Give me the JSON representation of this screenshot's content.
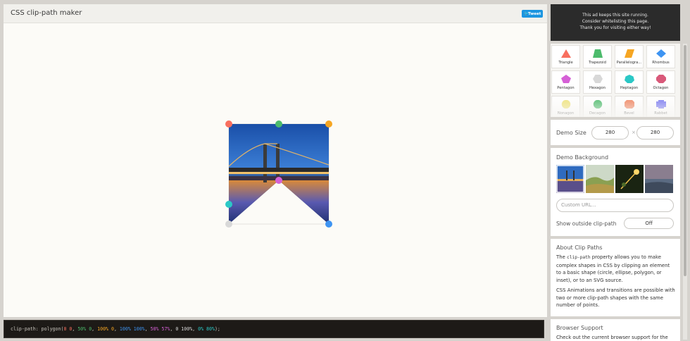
{
  "header": {
    "title": "CSS clip-path maker",
    "tweet_label": "Tweet"
  },
  "code": {
    "prefix": "clip-path: polygon(",
    "points": [
      "0 0",
      "50% 0",
      "100% 0",
      "100% 100%",
      "50% 57%",
      "0 100%",
      "0% 80%"
    ],
    "suffix": ");"
  },
  "ad": {
    "line1": "This ad keeps this site running.",
    "line2": "Consider whitelisting this page.",
    "line3": "Thank you for visiting either way!"
  },
  "shapes": [
    {
      "label": "Triangle",
      "icon": "triangle-icon",
      "color": "#f86f5f"
    },
    {
      "label": "Trapezoid",
      "icon": "trapezoid-icon",
      "color": "#4cbb6c"
    },
    {
      "label": "Parallelogra...",
      "icon": "parallelogram-icon",
      "color": "#f6a623"
    },
    {
      "label": "Rhombus",
      "icon": "rhombus-icon",
      "color": "#3e94f2"
    },
    {
      "label": "Pentagon",
      "icon": "pentagon-icon",
      "color": "#d560d6"
    },
    {
      "label": "Hexagon",
      "icon": "hexagon-icon",
      "color": "#d8d8d8"
    },
    {
      "label": "Heptagon",
      "icon": "heptagon-icon",
      "color": "#2bc8c6"
    },
    {
      "label": "Octagon",
      "icon": "octagon-icon",
      "color": "#d9597a"
    },
    {
      "label": "Nonagon",
      "icon": "nonagon-icon",
      "color": "#efe37a"
    },
    {
      "label": "Decagon",
      "icon": "decagon-icon",
      "color": "#4cbb6c"
    },
    {
      "label": "Bevel",
      "icon": "bevel-icon",
      "color": "#f0845f"
    },
    {
      "label": "Rabbet",
      "icon": "rabbet-icon",
      "color": "#7b7bf2"
    }
  ],
  "demo_size": {
    "label": "Demo Size",
    "width": "280",
    "height": "280",
    "separator": "×"
  },
  "demo_background": {
    "label": "Demo Background",
    "custom_url_placeholder": "Custom URL...",
    "outside_label": "Show outside clip-path",
    "outside_value": "Off"
  },
  "about": {
    "title": "About Clip Paths",
    "p1_before": "The ",
    "p1_code": "clip-path",
    "p1_after": " property allows you to make complex shapes in CSS by clipping an element to a basic shape (circle, ellipse, polygon, or inset), or to an SVG source.",
    "p2": "CSS Animations and transitions are possible with two or more clip-path shapes with the same number of points."
  },
  "support": {
    "title": "Browser Support",
    "text": "Check out the current browser support for the"
  },
  "colors": {
    "handle_colors": [
      "#f86f5f",
      "#4cbb6c",
      "#f6a623",
      "#3e94f2",
      "#d560d6",
      "#d8d8d8",
      "#2bc8c6"
    ]
  }
}
